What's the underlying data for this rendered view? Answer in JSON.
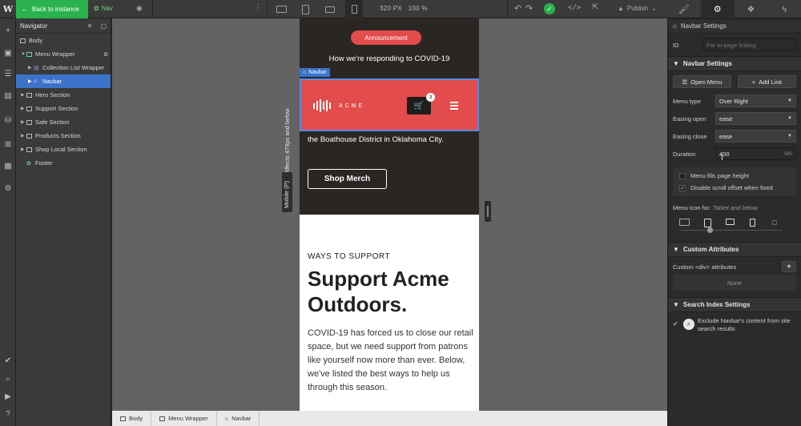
{
  "topbar": {
    "logo": "W",
    "back_label": "Back to instance",
    "nav_label": "Nav",
    "canvas_width": "320 PX",
    "zoom": "100 %",
    "publish_label": "Publish",
    "right_tabs": [
      "brush-icon",
      "gear-icon",
      "drops-icon",
      "bolt-icon"
    ]
  },
  "navigator": {
    "title": "Navigator",
    "items": [
      {
        "label": "Body"
      },
      {
        "label": "Menu Wrapper"
      },
      {
        "label": "Collection List Wrapper"
      },
      {
        "label": "Navbar"
      },
      {
        "label": "Hero Section"
      },
      {
        "label": "Support Section"
      },
      {
        "label": "Safe Section"
      },
      {
        "label": "Products Section"
      },
      {
        "label": "Shop Local Section"
      },
      {
        "label": "Footer"
      }
    ]
  },
  "canvas": {
    "announcement": "Announcement",
    "covid_line": "How we're responding to COVID-19",
    "navbar_tag": "Navbar",
    "brand": "ACME",
    "cart_count": "3",
    "hero_text": "the Boathouse District in Oklahoma City.",
    "shop_button": "Shop Merch",
    "support_eyebrow": "WAYS TO SUPPORT",
    "support_title": "Support Acme Outdoors.",
    "support_para": "COVID-19 has forced us to close our retail space, but we need support from patrons like yourself now more than ever. Below, we've listed the best ways to help us through this season.",
    "affects_label": "Affects 479px and below",
    "mobile_label": "Mobile (P)"
  },
  "breadcrumbs": [
    "Body",
    "Menu Wrapper",
    "Navbar"
  ],
  "panel": {
    "header": "Navbar Settings",
    "id_label": "ID",
    "id_placeholder": "For in-page linking",
    "section_title": "Navbar Settings",
    "open_menu": "Open Menu",
    "add_link": "Add Link",
    "menu_type_label": "Menu type",
    "menu_type_value": "Over Right",
    "easing_open_label": "Easing open",
    "easing_open_value": "ease",
    "easing_close_label": "Easing close",
    "easing_close_value": "ease",
    "duration_label": "Duration",
    "duration_value": "400",
    "duration_unit": "MS",
    "fills_page": "Menu fills page height",
    "disable_scroll": "Disable scroll offset when fixed",
    "menu_icon_for": "Menu icon for:",
    "menu_icon_scope": "Tablet and below",
    "custom_attributes": "Custom Attributes",
    "custom_div_attrs": "Custom <div> attributes",
    "none": "None",
    "search_index": "Search Index Settings",
    "exclude_text": "Exclude Navbar's content from site search results"
  }
}
